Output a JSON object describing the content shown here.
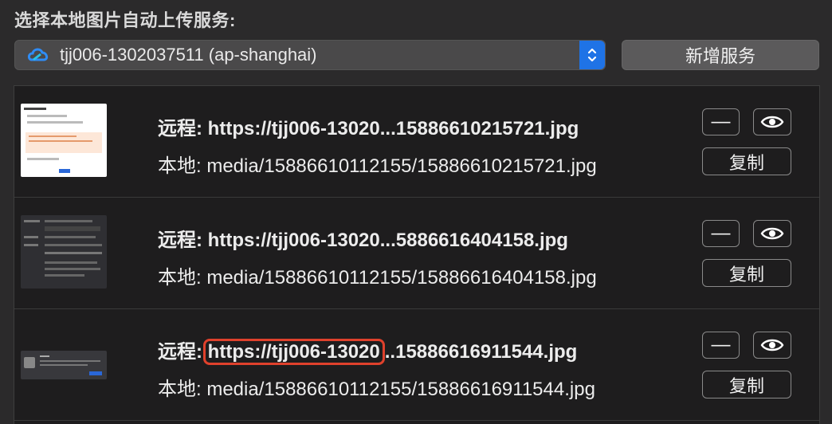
{
  "header": {
    "title": "选择本地图片自动上传服务:"
  },
  "service": {
    "selected": "tjj006-1302037511 (ap-shanghai)",
    "icon": "tencent-cloud-icon",
    "add_label": "新增服务"
  },
  "colors": {
    "accent": "#1f73e6",
    "highlight": "#e0412c"
  },
  "uploads": [
    {
      "remote_prefix": "远程:",
      "remote_url_head": "https://tjj006-13020",
      "remote_url_tail": "...15886610215721.jpg",
      "local_prefix": "本地:",
      "local_path": "media/15886610112155/15886610215721.jpg",
      "remove_label": "—",
      "copy_label": "复制"
    },
    {
      "remote_prefix": "远程:",
      "remote_url_head": "https://tjj006-13020",
      "remote_url_tail": "...5886616404158.jpg",
      "local_prefix": "本地:",
      "local_path": "media/15886610112155/15886616404158.jpg",
      "remove_label": "—",
      "copy_label": "复制"
    },
    {
      "remote_prefix": "远程:",
      "remote_url_head": "https://tjj006-13020",
      "remote_url_tail": "..15886616911544.jpg",
      "local_prefix": "本地:",
      "local_path": "media/15886610112155/15886616911544.jpg",
      "remove_label": "—",
      "copy_label": "复制"
    }
  ]
}
